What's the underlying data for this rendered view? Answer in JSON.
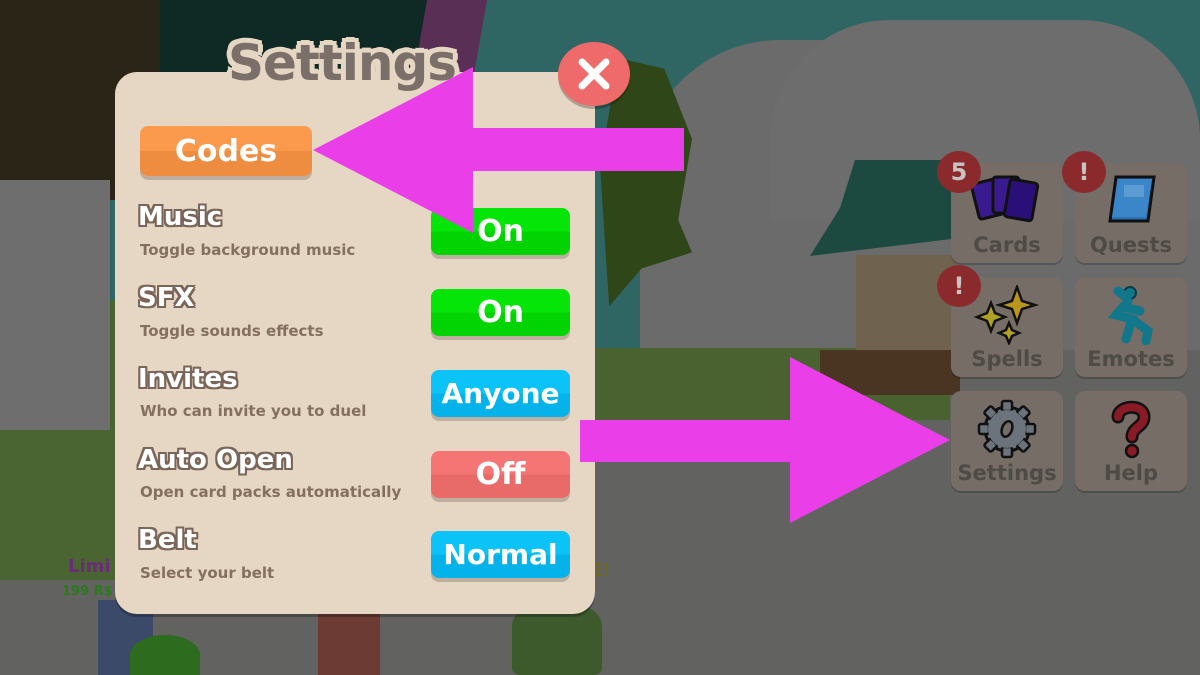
{
  "background": {
    "shop_label_partial": "Limi",
    "price_partial": "199 R$",
    "sale_partial": "E!"
  },
  "settings_panel": {
    "title": "Settings",
    "close_icon": "close-icon",
    "codes_button": "Codes",
    "rows": [
      {
        "label": "Music",
        "description": "Toggle background music",
        "value": "On",
        "state_color": "#04dd06"
      },
      {
        "label": "SFX",
        "description": "Toggle sounds effects",
        "value": "On",
        "state_color": "#04dd06"
      },
      {
        "label": "Invites",
        "description": "Who can invite you to duel",
        "value": "Anyone",
        "state_color": "#0bbcf2"
      },
      {
        "label": "Auto Open",
        "description": "Open card packs automatically",
        "value": "Off",
        "state_color": "#ef7070"
      },
      {
        "label": "Belt",
        "description": "Select your belt",
        "value": "Normal",
        "state_color": "#0bbcf2"
      }
    ]
  },
  "side_menu": {
    "items": [
      {
        "label": "Cards",
        "icon": "cards-icon",
        "badge": "5"
      },
      {
        "label": "Quests",
        "icon": "book-icon",
        "badge": "!"
      },
      {
        "label": "Spells",
        "icon": "sparkles-icon",
        "badge": "!"
      },
      {
        "label": "Emotes",
        "icon": "dancing-figure-icon",
        "badge": ""
      },
      {
        "label": "Settings",
        "icon": "gear-icon",
        "badge": ""
      },
      {
        "label": "Help",
        "icon": "question-mark-icon",
        "badge": ""
      }
    ]
  },
  "annotations": {
    "arrow_color": "#ea3fe8",
    "arrow_1": "points to Codes button",
    "arrow_2": "points to Settings menu button"
  }
}
